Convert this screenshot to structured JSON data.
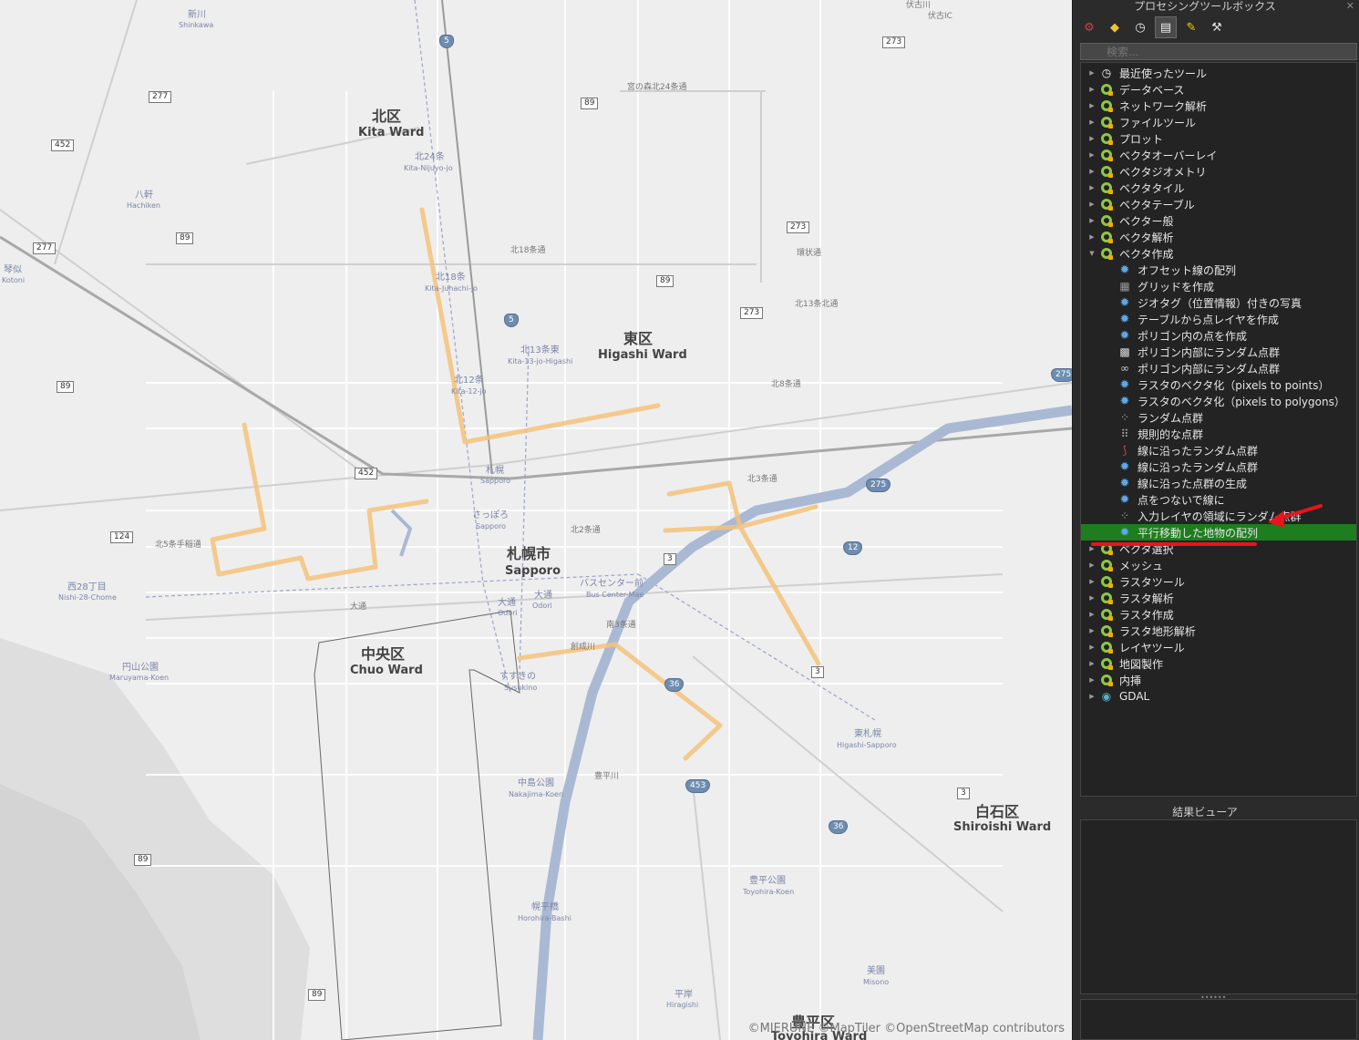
{
  "map": {
    "attribution": "©MIERUNE ©MapTiler ©OpenStreetMap contributors",
    "districts": [
      {
        "ja": "北区",
        "en": "Kita Ward"
      },
      {
        "ja": "東区",
        "en": "Higashi Ward"
      },
      {
        "ja": "中央区",
        "en": "Chuo Ward"
      },
      {
        "ja": "白石区",
        "en": "Shiroishi Ward"
      },
      {
        "ja": "豊平区",
        "en": "Toyohira Ward"
      },
      {
        "ja": "札幌市",
        "en": "Sapporo"
      }
    ],
    "stations": [
      {
        "ja": "新川",
        "en": "Shinkawa"
      },
      {
        "ja": "八軒",
        "en": "Hachiken"
      },
      {
        "ja": "琴似",
        "en": "Kotoni"
      },
      {
        "ja": "北24条",
        "en": "Kita-Nijuyo-jo"
      },
      {
        "ja": "北18条",
        "en": "Kita-Juhachi-jo"
      },
      {
        "ja": "北13条東",
        "en": "Kita-13-jo-Higashi"
      },
      {
        "ja": "北12条",
        "en": "Kita-12-jo"
      },
      {
        "ja": "札幌",
        "en": "Sapporo"
      },
      {
        "ja": "さっぽろ",
        "en": "Sapporo"
      },
      {
        "ja": "西28丁目",
        "en": "Nishi-28-Chome"
      },
      {
        "ja": "円山公園",
        "en": "Maruyama-Koen"
      },
      {
        "ja": "大通",
        "en": "Odori"
      },
      {
        "ja": "大通",
        "en": "Odori"
      },
      {
        "ja": "バスセンター前",
        "en": "Bus Center-Mae"
      },
      {
        "ja": "すすきの",
        "en": "Susukino"
      },
      {
        "ja": "中島公園",
        "en": "Nakajima-Koen"
      },
      {
        "ja": "幌平橋",
        "en": "Horohira-Bashi"
      },
      {
        "ja": "豊平公園",
        "en": "Toyohira-Koen"
      },
      {
        "ja": "東札幌",
        "en": "Higashi-Sapporo"
      },
      {
        "ja": "美園",
        "en": "Misono"
      },
      {
        "ja": "平岸",
        "en": "Hiragishi"
      }
    ],
    "route_numbers": [
      "5",
      "5",
      "89",
      "89",
      "89",
      "89",
      "89",
      "89",
      "273",
      "273",
      "273",
      "277",
      "277",
      "452",
      "452",
      "124",
      "3",
      "3",
      "3",
      "12",
      "36",
      "36",
      "275",
      "275",
      "453"
    ],
    "street_labels": [
      "宮の森北24条通",
      "北18条通",
      "北13条北通",
      "北8条通",
      "北5条手稲通",
      "北3条通",
      "北2条通",
      "大通",
      "南3条通",
      "環状通",
      "創成川",
      "豊平川",
      "伏古IC",
      "伏古川"
    ],
    "colors": {
      "overlay_line": "#f5c27a",
      "water": "#aab9d3",
      "land": "#eeeeee"
    }
  },
  "panel": {
    "title": "プロセシングツールボックス",
    "toolbar": [
      {
        "icon": "models-icon",
        "glyph": "⚙"
      },
      {
        "icon": "python-icon",
        "glyph": "🐍"
      },
      {
        "icon": "history-icon",
        "glyph": "🕓"
      },
      {
        "icon": "results-icon",
        "glyph": "📄"
      },
      {
        "icon": "edit-in-place-icon",
        "glyph": "✎"
      },
      {
        "icon": "options-icon",
        "glyph": "🔧"
      }
    ],
    "search_placeholder": "検索...",
    "tree": [
      {
        "label": "最近使ったツール",
        "kind": "clock",
        "expanded": false,
        "level": 0
      },
      {
        "label": "データベース",
        "kind": "qgis",
        "expanded": false,
        "level": 0
      },
      {
        "label": "ネットワーク解析",
        "kind": "qgis",
        "expanded": false,
        "level": 0
      },
      {
        "label": "ファイルツール",
        "kind": "qgis",
        "expanded": false,
        "level": 0
      },
      {
        "label": "プロット",
        "kind": "qgis",
        "expanded": false,
        "level": 0
      },
      {
        "label": "ベクタオーバーレイ",
        "kind": "qgis",
        "expanded": false,
        "level": 0
      },
      {
        "label": "ベクタジオメトリ",
        "kind": "qgis",
        "expanded": false,
        "level": 0
      },
      {
        "label": "ベクタタイル",
        "kind": "qgis",
        "expanded": false,
        "level": 0
      },
      {
        "label": "ベクタテーブル",
        "kind": "qgis",
        "expanded": false,
        "level": 0
      },
      {
        "label": "ベクター般",
        "kind": "qgis",
        "expanded": false,
        "level": 0
      },
      {
        "label": "ベクタ解析",
        "kind": "qgis",
        "expanded": false,
        "level": 0
      },
      {
        "label": "ベクタ作成",
        "kind": "qgis",
        "expanded": true,
        "level": 0
      },
      {
        "label": "オフセット線の配列",
        "kind": "gear",
        "level": 1
      },
      {
        "label": "グリッドを作成",
        "kind": "grid",
        "level": 1
      },
      {
        "label": "ジオタグ（位置情報）付きの写真",
        "kind": "gear",
        "level": 1
      },
      {
        "label": "テーブルから点レイヤを作成",
        "kind": "gear",
        "level": 1
      },
      {
        "label": "ポリゴン内の点を作成",
        "kind": "gear",
        "level": 1
      },
      {
        "label": "ポリゴン内部にランダム点群",
        "kind": "dots",
        "level": 1
      },
      {
        "label": "ポリゴン内部にランダム点群",
        "kind": "chain",
        "level": 1
      },
      {
        "label": "ラスタのベクタ化（pixels to points）",
        "kind": "gear",
        "level": 1
      },
      {
        "label": "ラスタのベクタ化（pixels to polygons）",
        "kind": "gear",
        "level": 1
      },
      {
        "label": "ランダム点群",
        "kind": "scatter",
        "level": 1
      },
      {
        "label": "規則的な点群",
        "kind": "regular",
        "level": 1
      },
      {
        "label": "線に沿ったランダム点群",
        "kind": "line-points",
        "level": 1
      },
      {
        "label": "線に沿ったランダム点群",
        "kind": "gear",
        "level": 1
      },
      {
        "label": "線に沿った点群の生成",
        "kind": "gear",
        "level": 1
      },
      {
        "label": "点をつないで線に",
        "kind": "gear",
        "level": 1
      },
      {
        "label": "入力レイヤの領域にランダム点群",
        "kind": "scatter",
        "level": 1
      },
      {
        "label": "平行移動した地物の配列",
        "kind": "gear",
        "level": 1,
        "selected": true
      },
      {
        "label": "ベクタ選択",
        "kind": "qgis",
        "expanded": false,
        "level": 0
      },
      {
        "label": "メッシュ",
        "kind": "qgis",
        "expanded": false,
        "level": 0
      },
      {
        "label": "ラスタツール",
        "kind": "qgis",
        "expanded": false,
        "level": 0
      },
      {
        "label": "ラスタ解析",
        "kind": "qgis",
        "expanded": false,
        "level": 0
      },
      {
        "label": "ラスタ作成",
        "kind": "qgis",
        "expanded": false,
        "level": 0
      },
      {
        "label": "ラスタ地形解析",
        "kind": "qgis",
        "expanded": false,
        "level": 0
      },
      {
        "label": "レイヤツール",
        "kind": "qgis",
        "expanded": false,
        "level": 0
      },
      {
        "label": "地図製作",
        "kind": "qgis",
        "expanded": false,
        "level": 0
      },
      {
        "label": "内挿",
        "kind": "qgis",
        "expanded": false,
        "level": 0
      },
      {
        "label": "GDAL",
        "kind": "gdal",
        "expanded": false,
        "level": 0
      }
    ],
    "results_title": "結果ビューア",
    "colors": {
      "selected": "#1e7d1e",
      "annotation": "#e8141e"
    }
  }
}
